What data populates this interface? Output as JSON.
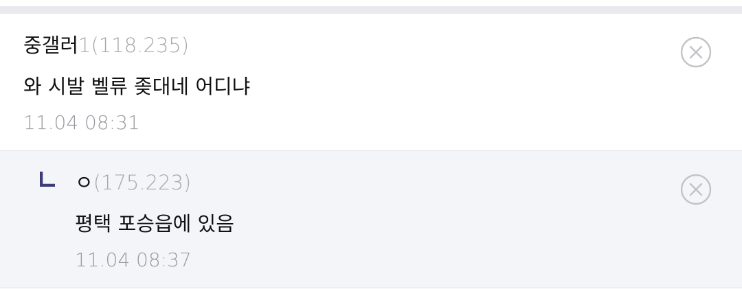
{
  "comments": [
    {
      "nickname": "중갤러",
      "nick_suffix": "1",
      "ip": "(118.235)",
      "content": "와 시발 벨류 좆대네 어디냐",
      "time": "11.04 08:31"
    }
  ],
  "replies": [
    {
      "nickname": "ㅇ",
      "ip": "(175.223)",
      "content": "평택 포승읍에 있음",
      "time": "11.04 08:37"
    }
  ],
  "colors": {
    "reply_background": "#f4f5f9",
    "reply_arrow": "#3a3d78",
    "muted_text": "#9a9aa1",
    "icon_gray": "#c2c2c8"
  },
  "icons": {
    "delete": "circle-x-icon",
    "reply": "reply-arrow-icon"
  }
}
